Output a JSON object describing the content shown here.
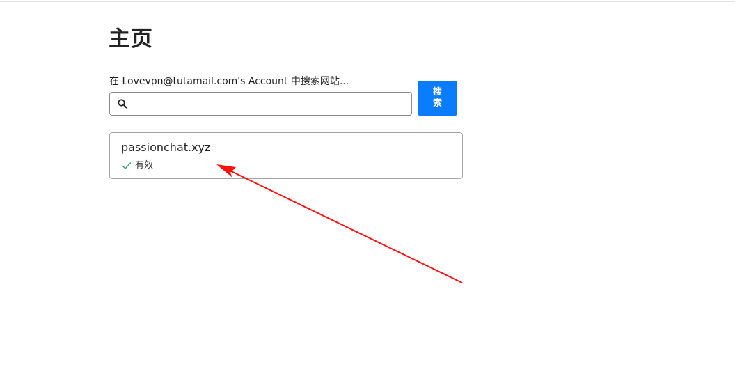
{
  "page": {
    "title": "主页"
  },
  "search": {
    "label": "在 Lovevpn@tutamail.com's Account 中搜索网站...",
    "value": "",
    "placeholder": "",
    "button_label": "搜索",
    "icon": "search-icon"
  },
  "results": [
    {
      "domain": "passionchat.xyz",
      "status": "有效",
      "status_icon": "check-icon",
      "status_color": "#2e9e6a"
    }
  ],
  "colors": {
    "accent": "#0a7cff",
    "annotation": "#ff1111"
  }
}
